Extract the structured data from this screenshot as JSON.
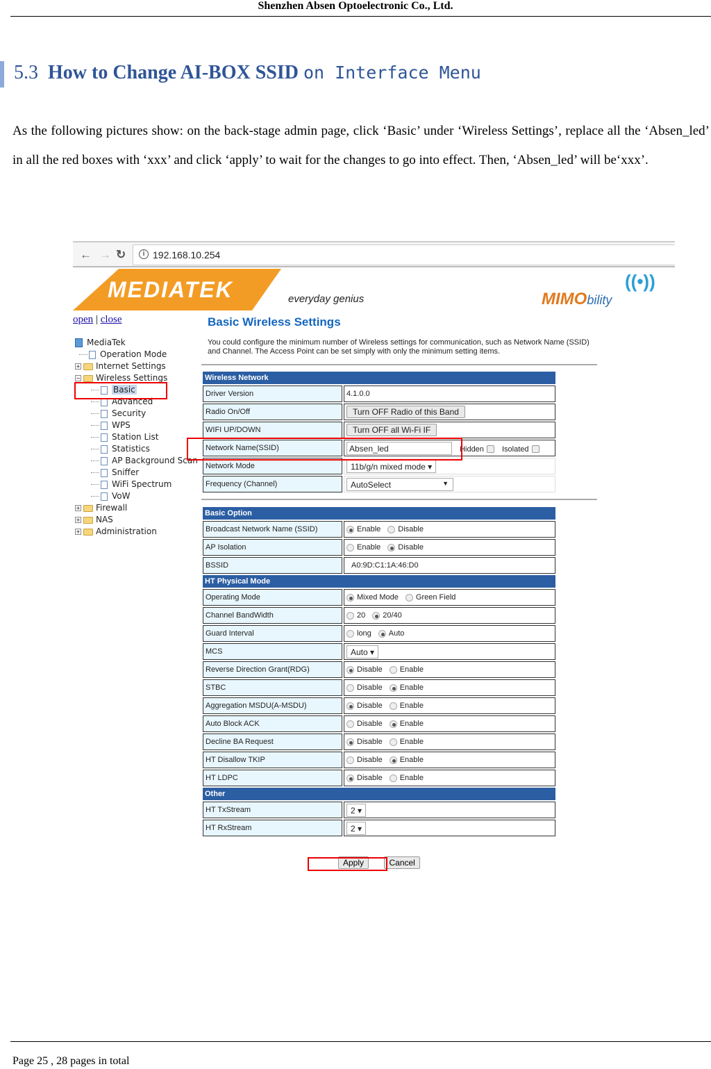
{
  "doc": {
    "header": "Shenzhen Absen Optoelectronic Co., Ltd.",
    "section_number": "5.3",
    "section_title_bold": "How to Change AI-BOX SSID",
    "section_title_mono": "on Interface Menu",
    "intro": "As the following pictures show: on the back-stage admin page, click ‘Basic’ under ‘Wireless Settings’, replace all the ‘Absen_led’ in all the red boxes with ‘xxx’ and click ‘apply’ to wait for the changes to go into effect. Then, ‘Absen_led’ will be‘xxx’.",
    "footer": "Page 25 , 28 pages in total"
  },
  "browser": {
    "back_icon": "arrow-left-icon",
    "forward_icon": "arrow-right-icon",
    "reload_icon": "reload-icon",
    "url": "192.168.10.254"
  },
  "banner": {
    "brand": "MEDIATEK",
    "tagline": "everyday genius",
    "mimo_a": "MIMO",
    "mimo_b": "bility"
  },
  "sidebar": {
    "open": "open",
    "sep": "|",
    "close": "close",
    "root": "MediaTek",
    "items": [
      {
        "label": "Operation Mode"
      },
      {
        "label": "Internet Settings"
      },
      {
        "label": "Wireless Settings"
      },
      {
        "label": "Basic"
      },
      {
        "label": "Advanced"
      },
      {
        "label": "Security"
      },
      {
        "label": "WPS"
      },
      {
        "label": "Station List"
      },
      {
        "label": "Statistics"
      },
      {
        "label": "AP Background Scan"
      },
      {
        "label": "Sniffer"
      },
      {
        "label": "WiFi Spectrum"
      },
      {
        "label": "VoW"
      },
      {
        "label": "Firewall"
      },
      {
        "label": "NAS"
      },
      {
        "label": "Administration"
      }
    ]
  },
  "page": {
    "title": "Basic Wireless Settings",
    "description": "You could configure the minimum number of Wireless settings for communication, such as Network Name (SSID) and Channel. The Access Point can be set simply with only the minimum setting items."
  },
  "wireless_network": {
    "header": "Wireless Network",
    "driver_version_label": "Driver Version",
    "driver_version": "4.1.0.0",
    "radio_label": "Radio On/Off",
    "radio_button": "Turn OFF Radio of this Band",
    "wifi_label": "WIFI UP/DOWN",
    "wifi_button": "Turn OFF all Wi-Fi IF",
    "ssid_label": "Network Name(SSID)",
    "ssid_value": "Absen_led",
    "hidden_label": "Hidden",
    "isolated_label": "Isolated",
    "mode_label": "Network Mode",
    "mode_value": "11b/g/n mixed mode ▾",
    "freq_label": "Frequency (Channel)",
    "freq_value": "AutoSelect"
  },
  "basic_option": {
    "header": "Basic Option",
    "rows": [
      {
        "label": "Broadcast Network Name (SSID)",
        "opt1": "Enable",
        "opt2": "Disable",
        "selected": 1
      },
      {
        "label": "AP Isolation",
        "opt1": "Enable",
        "opt2": "Disable",
        "selected": 2
      }
    ],
    "bssid_label": "BSSID",
    "bssid_value": "A0:9D:C1:1A:46:D0"
  },
  "ht_mode": {
    "header": "HT Physical Mode",
    "rows": [
      {
        "label": "Operating Mode",
        "opt1": "Mixed Mode",
        "opt2": "Green Field",
        "selected": 1
      },
      {
        "label": "Channel BandWidth",
        "opt1": "20",
        "opt2": "20/40",
        "selected": 2
      },
      {
        "label": "Guard Interval",
        "opt1": "long",
        "opt2": "Auto",
        "selected": 2
      }
    ],
    "mcs_label": "MCS",
    "mcs_value": "Auto ▾",
    "rows2": [
      {
        "label": "Reverse Direction Grant(RDG)",
        "opt1": "Disable",
        "opt2": "Enable",
        "selected": 1
      },
      {
        "label": "STBC",
        "opt1": "Disable",
        "opt2": "Enable",
        "selected": 2
      },
      {
        "label": "Aggregation MSDU(A-MSDU)",
        "opt1": "Disable",
        "opt2": "Enable",
        "selected": 1
      },
      {
        "label": "Auto Block ACK",
        "opt1": "Disable",
        "opt2": "Enable",
        "selected": 2
      },
      {
        "label": "Decline BA Request",
        "opt1": "Disable",
        "opt2": "Enable",
        "selected": 1
      },
      {
        "label": "HT Disallow TKIP",
        "opt1": "Disable",
        "opt2": "Enable",
        "selected": 2
      },
      {
        "label": "HT LDPC",
        "opt1": "Disable",
        "opt2": "Enable",
        "selected": 1
      }
    ]
  },
  "other": {
    "header": "Other",
    "tx_label": "HT TxStream",
    "tx_value": "2 ▾",
    "rx_label": "HT RxStream",
    "rx_value": "2 ▾"
  },
  "actions": {
    "apply": "Apply",
    "cancel": "Cancel"
  }
}
